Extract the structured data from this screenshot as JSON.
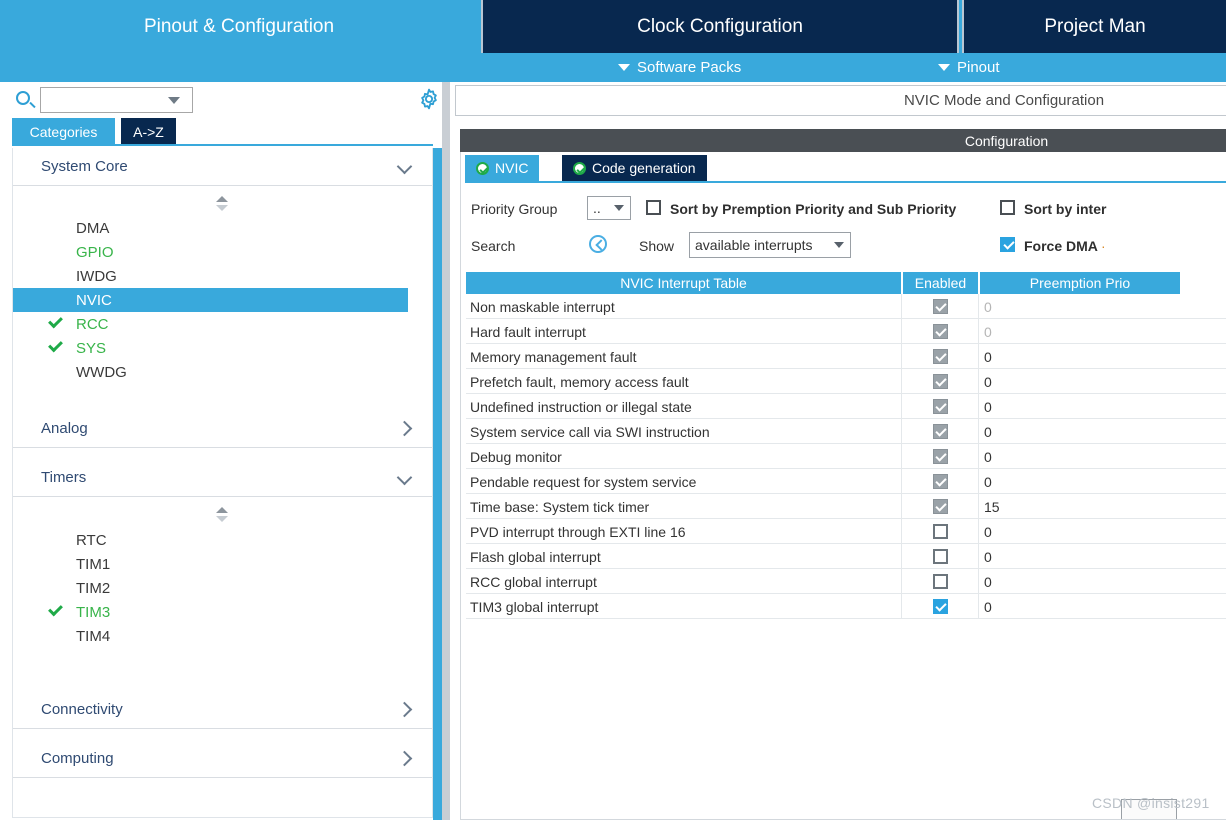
{
  "header": {
    "tabs": [
      {
        "label": "Pinout & Configuration",
        "active": true
      },
      {
        "label": "Clock Configuration",
        "active": false
      },
      {
        "label": "Project Man",
        "active": false
      }
    ],
    "subitems": [
      {
        "label": "Software Packs"
      },
      {
        "label": "Pinout"
      }
    ]
  },
  "sidebar": {
    "search": {
      "value": "",
      "placeholder": ""
    },
    "search_icon": "search-icon",
    "gear_icon": "gear-icon",
    "tabs": [
      {
        "label": "Categories",
        "active": true
      },
      {
        "label": "A->Z",
        "active": false
      }
    ],
    "groups": [
      {
        "label": "System Core",
        "expanded": true,
        "items": [
          {
            "label": "DMA",
            "state": "normal",
            "check": false
          },
          {
            "label": "GPIO",
            "state": "green",
            "check": false
          },
          {
            "label": "IWDG",
            "state": "normal",
            "check": false
          },
          {
            "label": "NVIC",
            "state": "selected",
            "check": false
          },
          {
            "label": "RCC",
            "state": "green",
            "check": true
          },
          {
            "label": "SYS",
            "state": "green",
            "check": true
          },
          {
            "label": "WWDG",
            "state": "normal",
            "check": false
          }
        ]
      },
      {
        "label": "Analog",
        "expanded": false,
        "items": []
      },
      {
        "label": "Timers",
        "expanded": true,
        "items": [
          {
            "label": "RTC",
            "state": "normal",
            "check": false
          },
          {
            "label": "TIM1",
            "state": "normal",
            "check": false
          },
          {
            "label": "TIM2",
            "state": "normal",
            "check": false
          },
          {
            "label": "TIM3",
            "state": "green",
            "check": true
          },
          {
            "label": "TIM4",
            "state": "normal",
            "check": false
          }
        ]
      },
      {
        "label": "Connectivity",
        "expanded": false,
        "items": []
      },
      {
        "label": "Computing",
        "expanded": false,
        "items": []
      }
    ]
  },
  "config": {
    "mode_title": "NVIC Mode and Configuration",
    "section_title": "Configuration",
    "tabs": [
      {
        "label": "NVIC",
        "active": true
      },
      {
        "label": "Code generation",
        "active": false
      }
    ],
    "priority_group_label": "Priority Group",
    "priority_group_value": "..",
    "sort_preemption_label": "Sort by Premption Priority and Sub Priority",
    "sort_preemption_checked": false,
    "sort_interrupt_label": "Sort by inter",
    "sort_interrupt_checked": false,
    "search_label": "Search",
    "search_collapse_icon": "chevron-left-circle-icon",
    "show_label": "Show",
    "show_value": "available interrupts",
    "force_dma_label": "Force DMA",
    "force_dma_checked": true
  },
  "table": {
    "columns": [
      "NVIC Interrupt Table",
      "Enabled",
      "Preemption Prio"
    ],
    "rows": [
      {
        "name": "Non maskable interrupt",
        "enabled": "locked-on",
        "priority": "0",
        "dim": true
      },
      {
        "name": "Hard fault interrupt",
        "enabled": "locked-on",
        "priority": "0",
        "dim": true
      },
      {
        "name": "Memory management fault",
        "enabled": "locked-on",
        "priority": "0",
        "dim": false
      },
      {
        "name": "Prefetch fault, memory access fault",
        "enabled": "locked-on",
        "priority": "0",
        "dim": false
      },
      {
        "name": "Undefined instruction or illegal state",
        "enabled": "locked-on",
        "priority": "0",
        "dim": false
      },
      {
        "name": "System service call via SWI instruction",
        "enabled": "locked-on",
        "priority": "0",
        "dim": false
      },
      {
        "name": "Debug monitor",
        "enabled": "locked-on",
        "priority": "0",
        "dim": false
      },
      {
        "name": "Pendable request for system service",
        "enabled": "locked-on",
        "priority": "0",
        "dim": false
      },
      {
        "name": "Time base: System tick timer",
        "enabled": "locked-on",
        "priority": "15",
        "dim": false
      },
      {
        "name": "PVD interrupt through EXTI line 16",
        "enabled": "off",
        "priority": "0",
        "dim": false
      },
      {
        "name": "Flash global interrupt",
        "enabled": "off",
        "priority": "0",
        "dim": false
      },
      {
        "name": "RCC global interrupt",
        "enabled": "off",
        "priority": "0",
        "dim": false
      },
      {
        "name": "TIM3 global interrupt",
        "enabled": "on",
        "priority": "0",
        "dim": false
      }
    ]
  },
  "watermark": "CSDN @insist291",
  "colors": {
    "accent": "#39a9dc",
    "dark_navy": "#08284f",
    "green": "#38b44a",
    "header_gray": "#4a4f54"
  }
}
